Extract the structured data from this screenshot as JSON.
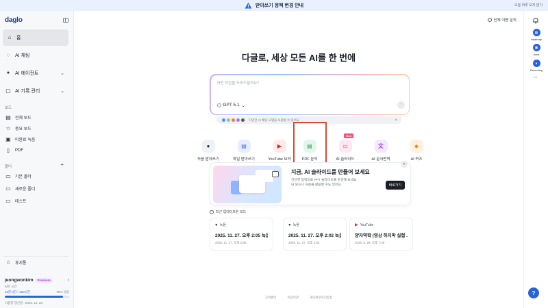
{
  "banner": {
    "text": "받아쓰기 정책 변경 안내",
    "hide_label": "오늘 하루 보지 않기"
  },
  "sidebar": {
    "logo": "daglo",
    "home": "홈",
    "nav": [
      {
        "label": "AI 채팅",
        "icon": "chat-icon"
      },
      {
        "label": "AI 에이전트",
        "icon": "sparkle-icon"
      },
      {
        "label": "AI 기록 관리",
        "icon": "ai-record-icon"
      }
    ],
    "board_section": "보드",
    "boards": [
      {
        "label": "전체 보드",
        "icon": "board-icon"
      },
      {
        "label": "중요 보드",
        "icon": "star-icon"
      },
      {
        "label": "미완료 녹음",
        "icon": "incomplete-icon"
      },
      {
        "label": "PDF",
        "icon": "pdf-icon"
      }
    ],
    "folder_section": "폴더",
    "folders": [
      {
        "label": "기본 폴더"
      },
      {
        "label": "새로운 폴더"
      },
      {
        "label": "테스트"
      }
    ],
    "trash": "휴지통",
    "user": {
      "name": "jeongwonkim",
      "badge": "Premium",
      "label": "남은 시간",
      "used": "10분시간 / 100시간",
      "percent_text": "90% 남음",
      "remaining_fraction": 0.9,
      "renew": "사용량 갱신일 : 2025. 12. 28."
    }
  },
  "main": {
    "inquiry": "단체 이용 문의",
    "headline": "다글로, 세상 모든 AI를 한 번에",
    "prompt": {
      "placeholder": "어떤 작업을 도와드릴까요?",
      "model": "GPT 5.1",
      "tip": "다양한 AI 채팅 모델을 사용할 수 있어요"
    },
    "tools": [
      {
        "label": "녹음 받아쓰기",
        "icon": "mic-icon",
        "glyph": "●",
        "bg": "#eef1f5",
        "fg": "#2a3038"
      },
      {
        "label": "파일 받아쓰기",
        "icon": "file-icon",
        "glyph": "▤",
        "bg": "#e6eeff",
        "fg": "#3a6df0"
      },
      {
        "label": "YouTube 요약",
        "icon": "youtube-icon",
        "glyph": "▶",
        "bg": "#ffe9e9",
        "fg": "#e02424"
      },
      {
        "label": "PDF 분석",
        "icon": "pdf-analysis-icon",
        "glyph": "▤",
        "bg": "#e4f6ec",
        "fg": "#1fa25a"
      },
      {
        "label": "AI 슬라이드",
        "icon": "slide-icon",
        "glyph": "▭",
        "bg": "#ffe8ef",
        "fg": "#ee4d7a",
        "badge": "New"
      },
      {
        "label": "AI 문서번역",
        "icon": "translate-icon",
        "glyph": "文",
        "bg": "#f3e8ff",
        "fg": "#9b45e0"
      },
      {
        "label": "AI 퀴즈",
        "icon": "quiz-icon",
        "glyph": "◆",
        "bg": "#fff1df",
        "fg": "#f08c1a"
      }
    ],
    "promo": {
      "title": "지금, AI 슬라이드를 만들어 보세요",
      "desc1": "간단한 입력으로 PPT 슬라이드를 완성해 보세요.",
      "desc2": "내 보드나 자료를 활용할 수도 있어요.",
      "button": "바로가기"
    },
    "recent_header": "최근 업데이트된 보드",
    "recent": [
      {
        "type": "녹음",
        "title": "2025. 11. 27. 오후 2:05 녹음",
        "sub": "2025. 11. 27. 오후 2:05",
        "icon": "mic-icon",
        "color": "#2a3038"
      },
      {
        "type": "녹음",
        "title": "2025. 11. 27. 오후 2:02 녹음",
        "sub": "2025. 11. 27. 오후 2:02",
        "icon": "mic-icon",
        "color": "#2a3038"
      },
      {
        "type": "YouTube",
        "title": "양자역학 (영상 하지막 실험 ...",
        "sub": "2025. 6. 28. 오후 7:49",
        "icon": "youtube-icon",
        "color": "#e02424"
      }
    ],
    "footer": [
      "고객센터",
      "이용약관",
      "개인정보처리방침"
    ]
  },
  "rail": {
    "apps": [
      {
        "label": "Heatmap",
        "icon": "heatmap-icon"
      },
      {
        "label": "Area",
        "icon": "area-icon"
      },
      {
        "label": "Recording",
        "icon": "recording-icon"
      }
    ],
    "help": "?"
  }
}
